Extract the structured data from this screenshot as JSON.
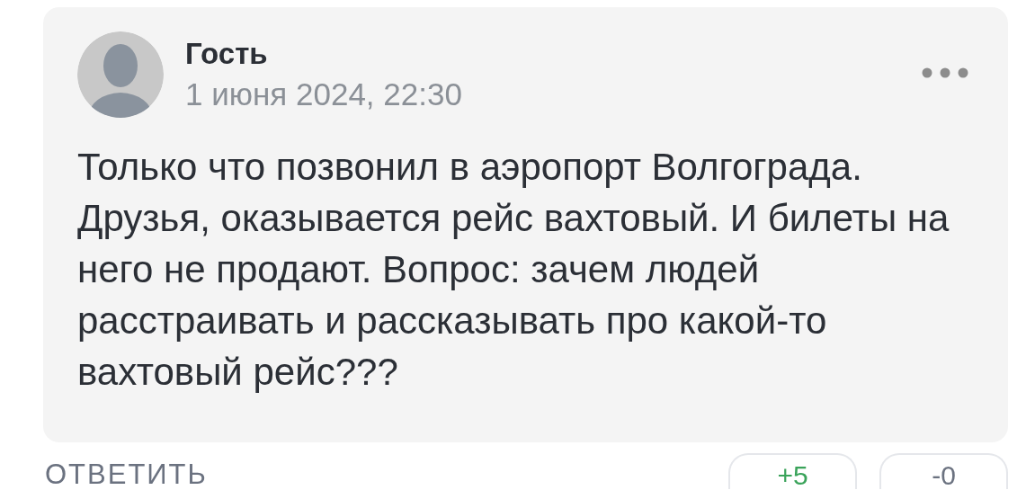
{
  "comment": {
    "author": "Гость",
    "date": "1 июня 2024, 22:30",
    "text": "Только что позвонил в аэропорт Волгограда. Друзья, оказывается рейс вахтовый. И билеты на него не продают. Вопрос: зачем людей расстраивать и рассказывать про какой-то вахтовый рейс???"
  },
  "actions": {
    "reply": "ОТВЕТИТЬ",
    "votes": [
      {
        "kind": "up",
        "label": "+5"
      },
      {
        "kind": "down",
        "label": "-0"
      }
    ]
  }
}
